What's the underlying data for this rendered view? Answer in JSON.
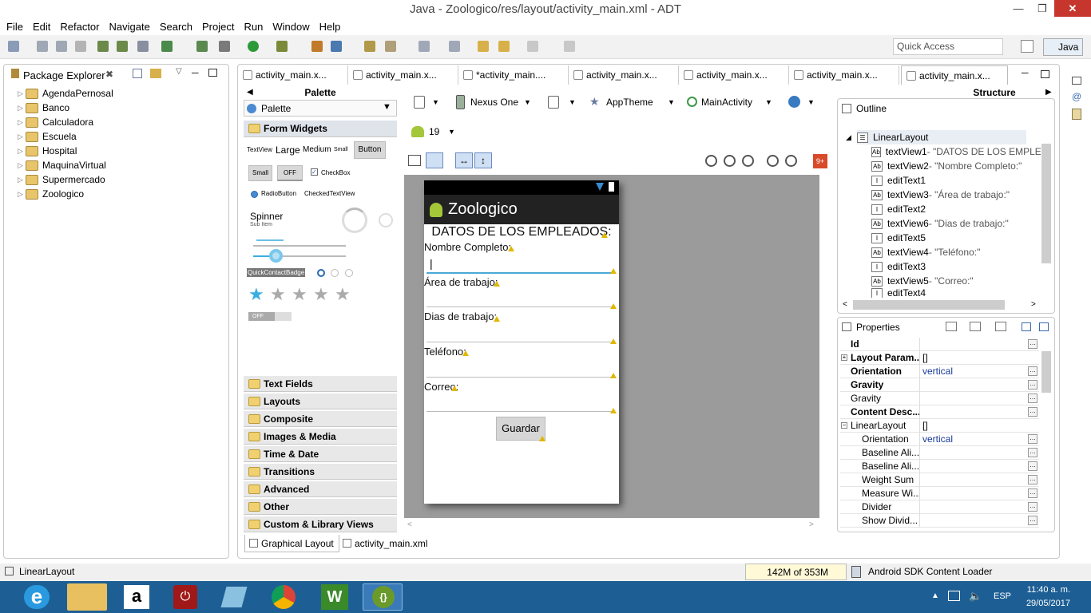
{
  "window": {
    "title": "Java - Zoologico/res/layout/activity_main.xml - ADT"
  },
  "menu": [
    "File",
    "Edit",
    "Refactor",
    "Navigate",
    "Search",
    "Project",
    "Run",
    "Window",
    "Help"
  ],
  "toolbar": {
    "quick_access": "Quick Access",
    "perspective": "Java"
  },
  "package_explorer": {
    "title": "Package Explorer",
    "projects": [
      "AgendaPernosal",
      "Banco",
      "Calculadora",
      "Escuela",
      "Hospital",
      "MaquinaVirtual",
      "Supermercado",
      "Zoologico"
    ]
  },
  "editor_tabs": [
    "activity_main.x...",
    "activity_main.x...",
    "*activity_main....",
    "activity_main.x...",
    "activity_main.x...",
    "activity_main.x...",
    "activity_main.x..."
  ],
  "palette": {
    "header": "Palette",
    "dropdown": "Palette",
    "open_category": "Form Widgets",
    "widgets": {
      "textview": "TextView",
      "large": "Large",
      "medium": "Medium",
      "small": "Small",
      "button": "Button",
      "small_btn": "Small",
      "off": "OFF",
      "checkbox": "CheckBox",
      "radio": "RadioButton",
      "checked_text": "CheckedTextView",
      "spinner": "Spinner",
      "sub_item": "Sub Item",
      "quick_contact": "QuickContactBadge",
      "switch_off": "OFF"
    },
    "categories": [
      "Text Fields",
      "Layouts",
      "Composite",
      "Images & Media",
      "Time & Date",
      "Transitions",
      "Advanced",
      "Other",
      "Custom & Library Views"
    ]
  },
  "layout_toolbar": {
    "device": "Nexus One",
    "theme": "AppTheme",
    "activity": "MainActivity",
    "api": "19"
  },
  "phone": {
    "app_title": "Zoologico",
    "heading": "DATOS DE LOS EMPLEADOS:",
    "labels": [
      "Nombre Completo:",
      "Área de trabajo:",
      "Dias de trabajo:",
      "Teléfono:",
      "Correo:"
    ],
    "cursor": "|",
    "button": "Guardar"
  },
  "structure": {
    "title": "Structure"
  },
  "outline": {
    "title": "Outline",
    "root": "LinearLayout",
    "items": [
      {
        "icon": "Ab",
        "name": "textView1",
        "label": " - \"DATOS DE LOS EMPLEA"
      },
      {
        "icon": "Ab",
        "name": "textView2",
        "label": " - \"Nombre Completo:\""
      },
      {
        "icon": "I",
        "name": "editText1",
        "label": ""
      },
      {
        "icon": "Ab",
        "name": "textView3",
        "label": " - \"Área de trabajo:\""
      },
      {
        "icon": "I",
        "name": "editText2",
        "label": ""
      },
      {
        "icon": "Ab",
        "name": "textView6",
        "label": " - \"Dias de trabajo:\""
      },
      {
        "icon": "I",
        "name": "editText5",
        "label": ""
      },
      {
        "icon": "Ab",
        "name": "textView4",
        "label": " - \"Teléfono:\""
      },
      {
        "icon": "I",
        "name": "editText3",
        "label": ""
      },
      {
        "icon": "Ab",
        "name": "textView5",
        "label": " - \"Correo:\""
      },
      {
        "icon": "I",
        "name": "editText4",
        "label": ""
      }
    ]
  },
  "properties": {
    "title": "Properties",
    "rows": [
      {
        "k": "Id",
        "v": ""
      },
      {
        "k": "Layout Param...",
        "v": "[]"
      },
      {
        "k": "Orientation",
        "v": "vertical"
      },
      {
        "k": "Gravity",
        "v": ""
      },
      {
        "k": "Gravity",
        "v": ""
      },
      {
        "k": "Content Desc...",
        "v": ""
      },
      {
        "k": "LinearLayout",
        "v": "[]"
      },
      {
        "k": "Orientation",
        "v": "vertical"
      },
      {
        "k": "Baseline Ali...",
        "v": ""
      },
      {
        "k": "Baseline Ali...",
        "v": ""
      },
      {
        "k": "Weight Sum",
        "v": ""
      },
      {
        "k": "Measure Wi...",
        "v": ""
      },
      {
        "k": "Divider",
        "v": ""
      },
      {
        "k": "Show Divid...",
        "v": ""
      }
    ]
  },
  "bottom_tabs": [
    "Graphical Layout",
    "activity_main.xml"
  ],
  "status": {
    "selection": "LinearLayout",
    "memory": "142M of 353M",
    "loader": "Android SDK Content Loader"
  },
  "taskbar": {
    "lang": "ESP",
    "time": "11:40 a. m.",
    "date": "29/05/2017"
  }
}
